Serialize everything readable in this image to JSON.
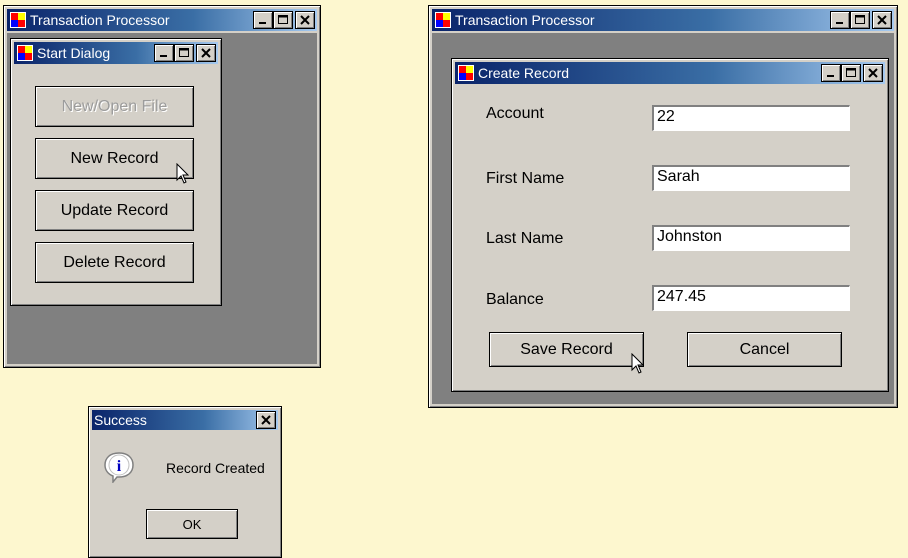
{
  "left_app": {
    "title": "Transaction Processor",
    "child": {
      "title": "Start Dialog",
      "buttons": {
        "new_open_file": "New/Open File",
        "new_record": "New Record",
        "update_record": "Update Record",
        "delete_record": "Delete Record"
      }
    }
  },
  "right_app": {
    "title": "Transaction Processor",
    "child": {
      "title": "Create Record",
      "fields": [
        {
          "label": "Account",
          "value": "22"
        },
        {
          "label": "First Name",
          "value": "Sarah"
        },
        {
          "label": "Last Name",
          "value": "Johnston"
        },
        {
          "label": "Balance",
          "value": "247.45"
        }
      ],
      "save_label": "Save Record",
      "cancel_label": "Cancel"
    }
  },
  "message_box": {
    "title": "Success",
    "message": "Record Created",
    "ok_label": "OK"
  },
  "colors": {
    "background": "#fdf7cf",
    "face": "#d4d0c8",
    "mdi": "#808080",
    "title_active": "#0a246a"
  }
}
